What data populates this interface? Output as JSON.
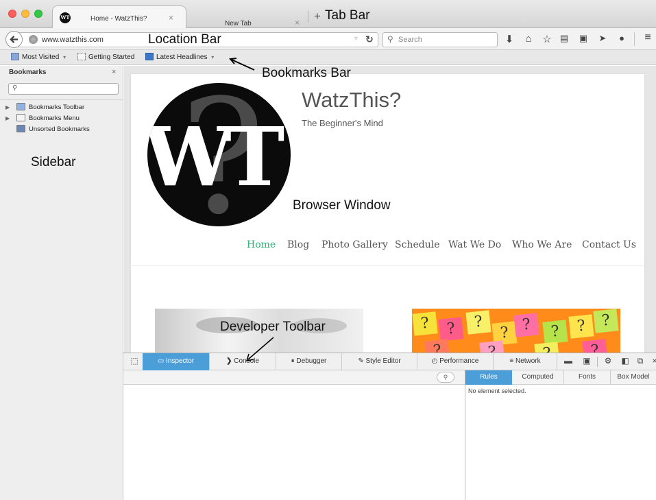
{
  "tabs": [
    {
      "title": "Home - WatzThis?",
      "close": "×",
      "favicon": "WT"
    },
    {
      "title": "New Tab",
      "close": "×"
    }
  ],
  "new_tab_label": "+",
  "nav": {
    "url": "www.watzthis.com",
    "search_placeholder": "Search",
    "back_icon": "back-arrow-icon"
  },
  "bookmarks_bar": [
    {
      "label": "Most Visited",
      "icon": "folder-icon",
      "dropdown": "▾"
    },
    {
      "label": "Getting Started",
      "icon": "page-icon"
    },
    {
      "label": "Latest Headlines",
      "icon": "rss-icon",
      "dropdown": "▾"
    }
  ],
  "sidebar": {
    "title": "Bookmarks",
    "close": "×",
    "items": [
      {
        "label": "Bookmarks Toolbar",
        "twisty": "▶"
      },
      {
        "label": "Bookmarks Menu",
        "twisty": "▶"
      },
      {
        "label": "Unsorted Bookmarks",
        "twisty": ""
      }
    ]
  },
  "page": {
    "logo_text": "WT",
    "logo_mark": "?",
    "site_title": "WatzThis?",
    "tagline": "The Beginner's Mind",
    "accent": "#26b573",
    "menu": [
      "Home",
      "Blog",
      "Photo Gallery",
      "Schedule",
      "Wat We Do",
      "Who We Are",
      "Contact Us"
    ]
  },
  "devtools": {
    "tabs": [
      "Inspector",
      "Console",
      "Debugger",
      "Style Editor",
      "Performance",
      "Network"
    ],
    "side_tabs": [
      "Rules",
      "Computed",
      "Fonts",
      "Box Model"
    ],
    "empty_message": "No element selected.",
    "accent": "#4c9ed9"
  },
  "annotations": {
    "tab_bar": "Tab Bar",
    "location_bar": "Location Bar",
    "bookmarks_bar": "Bookmarks Bar",
    "sidebar": "Sidebar",
    "browser_window": "Browser Window",
    "developer_toolbar": "Developer Toolbar"
  }
}
